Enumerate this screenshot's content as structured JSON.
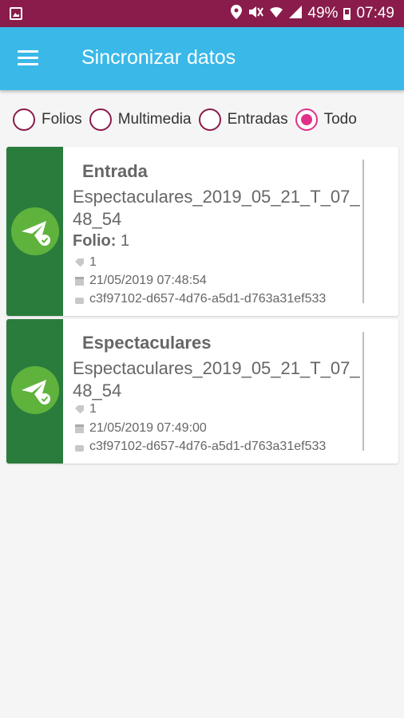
{
  "status_bar": {
    "battery": "49%",
    "time": "07:49"
  },
  "app_bar": {
    "title": "Sincronizar datos"
  },
  "filters": [
    {
      "label": "Folios",
      "checked": false
    },
    {
      "label": "Multimedia",
      "checked": false
    },
    {
      "label": "Entradas",
      "checked": false
    },
    {
      "label": "Todo",
      "checked": true
    }
  ],
  "cards": [
    {
      "title": "Entrada",
      "name": "Espectaculares_2019_05_21_T_07_48_54",
      "folio_label": "Folio:",
      "folio_value": "1",
      "tag": "1",
      "date": "21/05/2019 07:48:54",
      "uuid": "c3f97102-d657-4d76-a5d1-d763a31ef533"
    },
    {
      "title": "Espectaculares",
      "name": "Espectaculares_2019_05_21_T_07_48_54",
      "tag": "1",
      "date": "21/05/2019 07:49:00",
      "uuid": "c3f97102-d657-4d76-a5d1-d763a31ef533"
    }
  ],
  "colors": {
    "status_bar": "#8a1c4b",
    "app_bar": "#3ab8e8",
    "card_side": "#2a7c3c",
    "badge": "#5fb33d",
    "radio_checked": "#e0318a"
  },
  "icons": [
    "image-icon",
    "location-icon",
    "mute-icon",
    "wifi-icon",
    "signal-icon",
    "battery-icon",
    "menu-icon",
    "sent-check-icon",
    "tag-icon",
    "calendar-icon",
    "lock-icon"
  ]
}
